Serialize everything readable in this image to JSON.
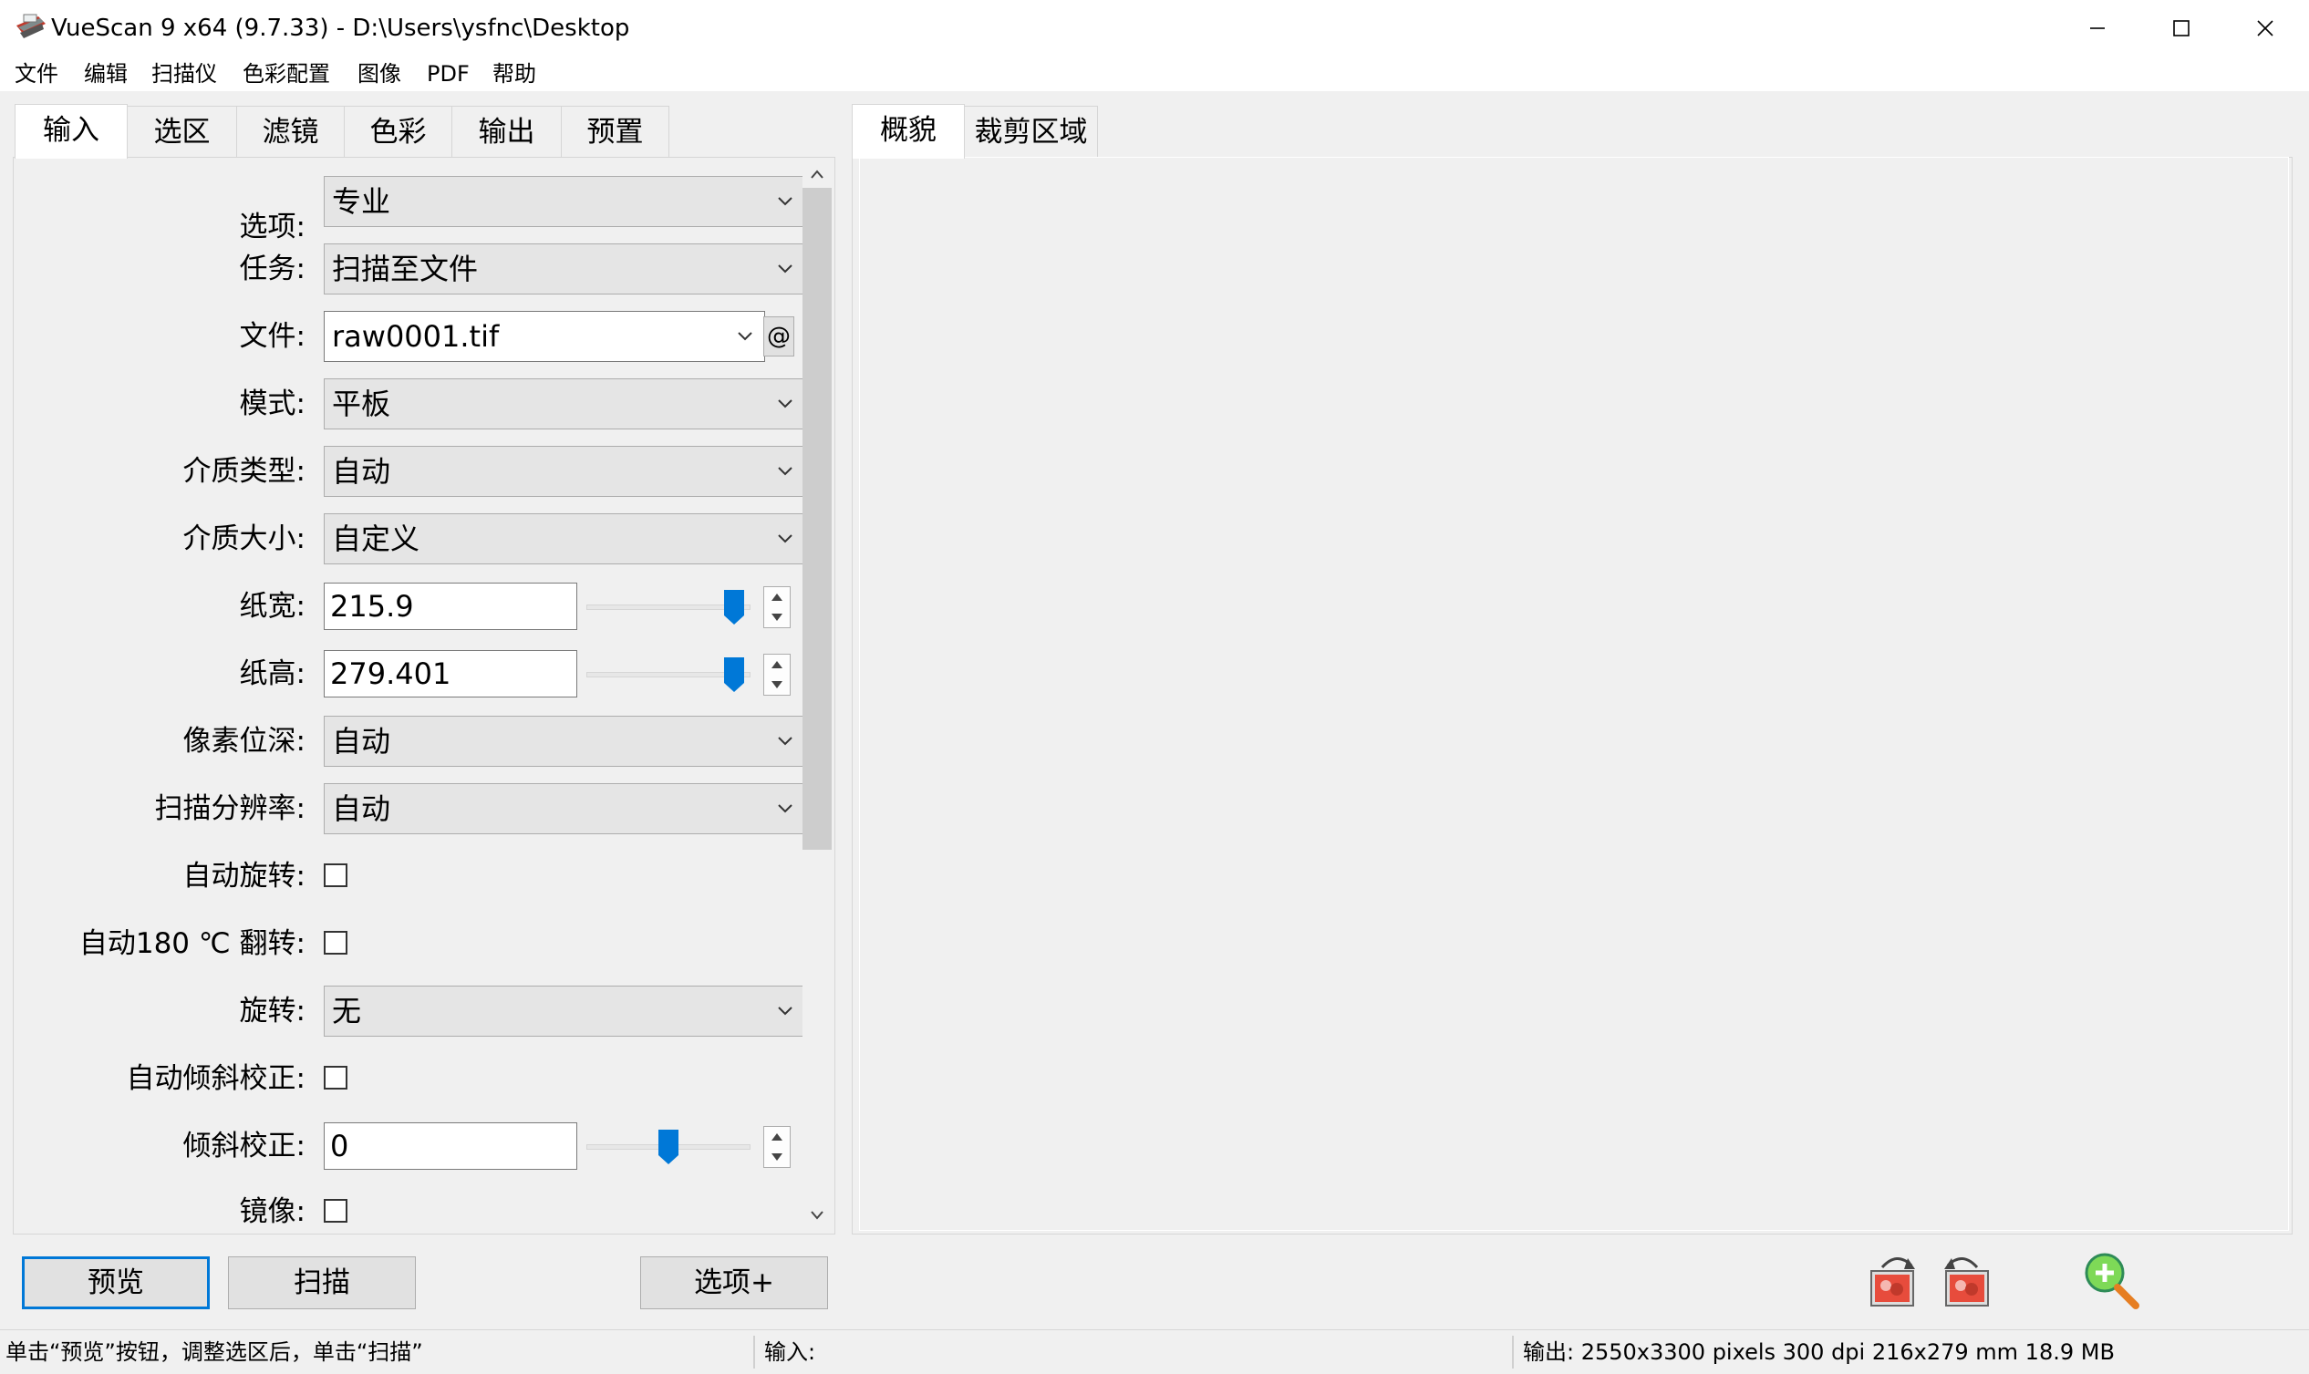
{
  "window": {
    "title": "VueScan 9 x64 (9.7.33) - D:\\Users\\ysfnc\\Desktop",
    "icon": "scanner-app-icon"
  },
  "menu": [
    "文件",
    "编辑",
    "扫描仪",
    "色彩配置",
    "图像",
    "PDF",
    "帮助"
  ],
  "left_tabs": [
    "输入",
    "选区",
    "滤镜",
    "色彩",
    "输出",
    "预置"
  ],
  "left_active_tab": "输入",
  "right_tabs": [
    "概貌",
    "裁剪区域"
  ],
  "right_active_tab": "概貌",
  "form": {
    "options": {
      "label": "选项:",
      "value": "专业"
    },
    "task": {
      "label": "任务:",
      "value": "扫描至文件"
    },
    "file": {
      "label": "文件:",
      "value": "raw0001.tif",
      "at_label": "@"
    },
    "mode": {
      "label": "模式:",
      "value": "平板"
    },
    "media_type": {
      "label": "介质类型:",
      "value": "自动"
    },
    "media_size": {
      "label": "介质大小:",
      "value": "自定义"
    },
    "paper_width": {
      "label": "纸宽:",
      "value": "215.9",
      "slider_fraction": 0.9
    },
    "paper_height": {
      "label": "纸高:",
      "value": "279.401",
      "slider_fraction": 0.9
    },
    "bit_depth": {
      "label": "像素位深:",
      "value": "自动"
    },
    "resolution": {
      "label": "扫描分辨率:",
      "value": "自动"
    },
    "auto_rotate": {
      "label": "自动旋转:",
      "checked": false
    },
    "auto_flip": {
      "label": "自动180 ℃ 翻转:",
      "checked": false
    },
    "rotation": {
      "label": "旋转:",
      "value": "无"
    },
    "auto_deskew": {
      "label": "自动倾斜校正:",
      "checked": false
    },
    "deskew": {
      "label": "倾斜校正:",
      "value": "0",
      "slider_fraction": 0.5
    },
    "mirror": {
      "label": "镜像:",
      "checked": false
    }
  },
  "buttons": {
    "preview": "预览",
    "scan": "扫描",
    "more_options": "选项+"
  },
  "status": {
    "hint": "单击“预览”按钮，调整选区后，单击“扫描”",
    "input": "输入:",
    "output": "输出: 2550x3300 pixels 300 dpi 216x279 mm 18.9 MB"
  },
  "colors": {
    "accent": "#0078d7",
    "window_bg": "#f0f0f0",
    "combo_bg": "#e5e5e5"
  }
}
